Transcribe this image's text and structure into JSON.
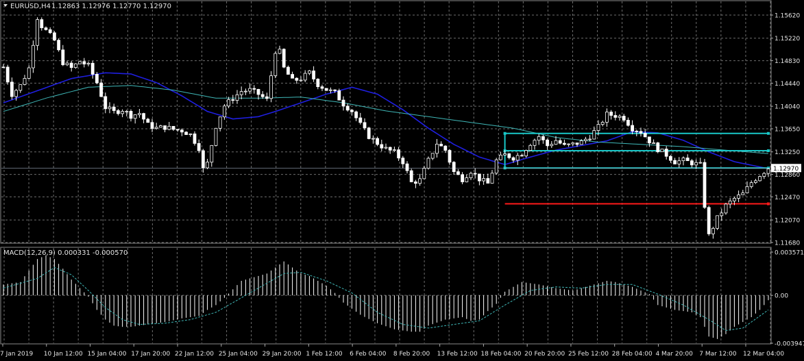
{
  "chart_data": [
    {
      "type": "candlestick",
      "symbol_header": "EURUSD,H4",
      "ohlc_header": [
        "1.12863",
        "1.12976",
        "1.12770",
        "1.12970"
      ],
      "current_price_label": "1.12970",
      "y_ticks": [
        "1.15620",
        "1.15220",
        "1.14830",
        "1.14440",
        "1.14040",
        "1.13650",
        "1.13250",
        "1.12860",
        "1.12470",
        "1.12070",
        "1.11680"
      ],
      "ylim": [
        1.1168,
        1.1562
      ],
      "x_tick_labels": [
        "7 Jan 2019",
        "10 Jan 12:00",
        "15 Jan 04:00",
        "17 Jan 20:00",
        "22 Jan 12:00",
        "25 Jan 04:00",
        "29 Jan 20:00",
        "1 Feb 12:00",
        "6 Feb 04:00",
        "8 Feb 20:00",
        "13 Feb 12:00",
        "18 Feb 04:00",
        "20 Feb 20:00",
        "25 Feb 12:00",
        "28 Feb 04:00",
        "4 Mar 20:00",
        "7 Mar 12:00",
        "12 Mar 04:00"
      ],
      "close_path": [
        [
          0,
          1.1472
        ],
        [
          2,
          1.1425
        ],
        [
          4,
          1.144
        ],
        [
          6,
          1.147
        ],
        [
          8,
          1.1558
        ],
        [
          9,
          1.1543
        ],
        [
          10,
          1.1535
        ],
        [
          12,
          1.1518
        ],
        [
          14,
          1.148
        ],
        [
          16,
          1.147
        ],
        [
          18,
          1.1482
        ],
        [
          20,
          1.1474
        ],
        [
          22,
          1.1445
        ],
        [
          24,
          1.1402
        ],
        [
          26,
          1.1394
        ],
        [
          28,
          1.1398
        ],
        [
          30,
          1.1388
        ],
        [
          32,
          1.1392
        ],
        [
          34,
          1.1372
        ],
        [
          36,
          1.1366
        ],
        [
          38,
          1.1368
        ],
        [
          40,
          1.1364
        ],
        [
          42,
          1.1362
        ],
        [
          44,
          1.1355
        ],
        [
          46,
          1.1332
        ],
        [
          47,
          1.1295
        ],
        [
          48,
          1.1305
        ],
        [
          50,
          1.137
        ],
        [
          52,
          1.1405
        ],
        [
          54,
          1.1418
        ],
        [
          56,
          1.143
        ],
        [
          58,
          1.1432
        ],
        [
          60,
          1.1425
        ],
        [
          62,
          1.1415
        ],
        [
          64,
          1.15
        ],
        [
          65,
          1.1498
        ],
        [
          66,
          1.147
        ],
        [
          68,
          1.1448
        ],
        [
          70,
          1.1452
        ],
        [
          72,
          1.1462
        ],
        [
          74,
          1.1442
        ],
        [
          76,
          1.1433
        ],
        [
          78,
          1.1427
        ],
        [
          80,
          1.1408
        ],
        [
          82,
          1.1396
        ],
        [
          84,
          1.1372
        ],
        [
          86,
          1.1352
        ],
        [
          88,
          1.134
        ],
        [
          90,
          1.133
        ],
        [
          92,
          1.1324
        ],
        [
          94,
          1.1308
        ],
        [
          96,
          1.1272
        ],
        [
          98,
          1.1276
        ],
        [
          100,
          1.131
        ],
        [
          102,
          1.134
        ],
        [
          104,
          1.1328
        ],
        [
          106,
          1.129
        ],
        [
          108,
          1.1278
        ],
        [
          110,
          1.1292
        ],
        [
          112,
          1.1278
        ],
        [
          114,
          1.127
        ],
        [
          116,
          1.131
        ],
        [
          118,
          1.132
        ],
        [
          120,
          1.1315
        ],
        [
          122,
          1.1322
        ],
        [
          124,
          1.134
        ],
        [
          126,
          1.1352
        ],
        [
          128,
          1.1336
        ],
        [
          130,
          1.1345
        ],
        [
          132,
          1.1335
        ],
        [
          134,
          1.1338
        ],
        [
          136,
          1.1342
        ],
        [
          138,
          1.1352
        ],
        [
          140,
          1.1368
        ],
        [
          142,
          1.139
        ],
        [
          144,
          1.1388
        ],
        [
          146,
          1.1384
        ],
        [
          148,
          1.1366
        ],
        [
          150,
          1.136
        ],
        [
          152,
          1.1344
        ],
        [
          154,
          1.133
        ],
        [
          156,
          1.132
        ],
        [
          158,
          1.1308
        ],
        [
          160,
          1.131
        ],
        [
          162,
          1.1306
        ],
        [
          164,
          1.1302
        ],
        [
          165,
          1.1232
        ],
        [
          166,
          1.118
        ],
        [
          168,
          1.121
        ],
        [
          170,
          1.1232
        ],
        [
          172,
          1.1244
        ],
        [
          174,
          1.1252
        ],
        [
          176,
          1.1272
        ],
        [
          178,
          1.1285
        ],
        [
          180,
          1.1297
        ]
      ],
      "moving_averages": [
        {
          "color": "#1f1fe0",
          "values": [
            [
              0,
              1.141
            ],
            [
              16,
              1.1452
            ],
            [
              24,
              1.1462
            ],
            [
              30,
              1.146
            ],
            [
              36,
              1.1445
            ],
            [
              42,
              1.1422
            ],
            [
              48,
              1.1395
            ],
            [
              54,
              1.1382
            ],
            [
              60,
              1.1386
            ],
            [
              64,
              1.1395
            ],
            [
              70,
              1.141
            ],
            [
              76,
              1.1425
            ],
            [
              82,
              1.1437
            ],
            [
              88,
              1.1425
            ],
            [
              94,
              1.1398
            ],
            [
              100,
              1.1366
            ],
            [
              106,
              1.1338
            ],
            [
              112,
              1.1316
            ],
            [
              118,
              1.1303
            ],
            [
              124,
              1.1316
            ],
            [
              130,
              1.1328
            ],
            [
              136,
              1.1336
            ],
            [
              142,
              1.1344
            ],
            [
              148,
              1.136
            ],
            [
              154,
              1.1358
            ],
            [
              160,
              1.1345
            ],
            [
              166,
              1.1325
            ],
            [
              172,
              1.1308
            ],
            [
              180,
              1.1296
            ]
          ]
        },
        {
          "color": "#3fb8b8",
          "values": [
            [
              0,
              1.1395
            ],
            [
              10,
              1.1418
            ],
            [
              20,
              1.1437
            ],
            [
              30,
              1.144
            ],
            [
              40,
              1.1432
            ],
            [
              50,
              1.1418
            ],
            [
              60,
              1.1418
            ],
            [
              70,
              1.142
            ],
            [
              80,
              1.141
            ],
            [
              90,
              1.1396
            ],
            [
              100,
              1.1386
            ],
            [
              110,
              1.1376
            ],
            [
              120,
              1.1366
            ],
            [
              130,
              1.135
            ],
            [
              140,
              1.1342
            ],
            [
              150,
              1.1338
            ],
            [
              160,
              1.1334
            ],
            [
              170,
              1.1328
            ],
            [
              180,
              1.1322
            ]
          ]
        }
      ],
      "horizontal_lines": [
        {
          "price": 1.1357,
          "color": "#19c8c8",
          "from": 118,
          "to": 180
        },
        {
          "price": 1.1327,
          "color": "#19c8c8",
          "from": 118,
          "to": 180
        },
        {
          "price": 1.1297,
          "color": "#19c8c8",
          "from": 118,
          "to": 180
        },
        {
          "price": 1.1235,
          "color": "#ff1a1a",
          "from": 118,
          "to": 180
        }
      ],
      "bars": 181
    },
    {
      "type": "macd",
      "label": "MACD(12,26,9) 0.000331 -0.000570",
      "y_ticks": [
        "0.003571",
        "0.00",
        "-0.003947"
      ],
      "ylim": [
        -0.003947,
        0.003571
      ],
      "histogram_path": [
        [
          0,
          0.0009
        ],
        [
          4,
          0.0011
        ],
        [
          8,
          0.003
        ],
        [
          10,
          0.0033
        ],
        [
          12,
          0.003
        ],
        [
          14,
          0.0022
        ],
        [
          16,
          0.0013
        ],
        [
          18,
          0.0006
        ],
        [
          20,
          -0.0001
        ],
        [
          22,
          -0.0012
        ],
        [
          24,
          -0.002
        ],
        [
          26,
          -0.0025
        ],
        [
          28,
          -0.0026
        ],
        [
          30,
          -0.0026
        ],
        [
          34,
          -0.0024
        ],
        [
          38,
          -0.0022
        ],
        [
          42,
          -0.0019
        ],
        [
          46,
          -0.0017
        ],
        [
          48,
          -0.0012
        ],
        [
          50,
          -0.0008
        ],
        [
          52,
          -0.0002
        ],
        [
          56,
          0.0012
        ],
        [
          60,
          0.0016
        ],
        [
          62,
          0.0018
        ],
        [
          66,
          0.0028
        ],
        [
          68,
          0.0023
        ],
        [
          70,
          0.0018
        ],
        [
          72,
          0.0016
        ],
        [
          74,
          0.0012
        ],
        [
          76,
          0.0008
        ],
        [
          78,
          0.0002
        ],
        [
          80,
          -0.0006
        ],
        [
          84,
          -0.0016
        ],
        [
          88,
          -0.0023
        ],
        [
          92,
          -0.0028
        ],
        [
          96,
          -0.003
        ],
        [
          98,
          -0.003
        ],
        [
          100,
          -0.0025
        ],
        [
          104,
          -0.002
        ],
        [
          108,
          -0.0018
        ],
        [
          110,
          -0.0021
        ],
        [
          112,
          -0.002
        ],
        [
          114,
          -0.0013
        ],
        [
          116,
          -0.0007
        ],
        [
          118,
          0.0003
        ],
        [
          122,
          0.0011
        ],
        [
          126,
          0.0009
        ],
        [
          130,
          0.0006
        ],
        [
          134,
          0.0004
        ],
        [
          138,
          0.0008
        ],
        [
          142,
          0.0012
        ],
        [
          144,
          0.0011
        ],
        [
          148,
          0.0007
        ],
        [
          152,
          0.0001
        ],
        [
          154,
          -0.0008
        ],
        [
          158,
          -0.0012
        ],
        [
          162,
          -0.0014
        ],
        [
          164,
          -0.0018
        ],
        [
          166,
          -0.0034
        ],
        [
          168,
          -0.0036
        ],
        [
          170,
          -0.0032
        ],
        [
          172,
          -0.0026
        ],
        [
          174,
          -0.0022
        ],
        [
          176,
          -0.0018
        ],
        [
          178,
          -0.0012
        ],
        [
          180,
          -0.0004
        ]
      ],
      "signal_path": [
        [
          0,
          0.0006
        ],
        [
          8,
          0.0014
        ],
        [
          12,
          0.0023
        ],
        [
          16,
          0.0017
        ],
        [
          20,
          0.0004
        ],
        [
          24,
          -0.001
        ],
        [
          28,
          -0.002
        ],
        [
          32,
          -0.0024
        ],
        [
          38,
          -0.0023
        ],
        [
          44,
          -0.002
        ],
        [
          50,
          -0.0014
        ],
        [
          56,
          -0.0002
        ],
        [
          62,
          0.001
        ],
        [
          66,
          0.0018
        ],
        [
          70,
          0.0019
        ],
        [
          76,
          0.0012
        ],
        [
          82,
          0.0002
        ],
        [
          88,
          -0.0014
        ],
        [
          94,
          -0.0024
        ],
        [
          100,
          -0.0027
        ],
        [
          106,
          -0.0024
        ],
        [
          112,
          -0.0021
        ],
        [
          118,
          -0.0008
        ],
        [
          124,
          0.0004
        ],
        [
          130,
          0.0007
        ],
        [
          136,
          0.0006
        ],
        [
          142,
          0.0009
        ],
        [
          148,
          0.0009
        ],
        [
          154,
          0.0001
        ],
        [
          160,
          -0.0008
        ],
        [
          166,
          -0.002
        ],
        [
          170,
          -0.0029
        ],
        [
          174,
          -0.0027
        ],
        [
          180,
          -0.0012
        ]
      ]
    }
  ]
}
